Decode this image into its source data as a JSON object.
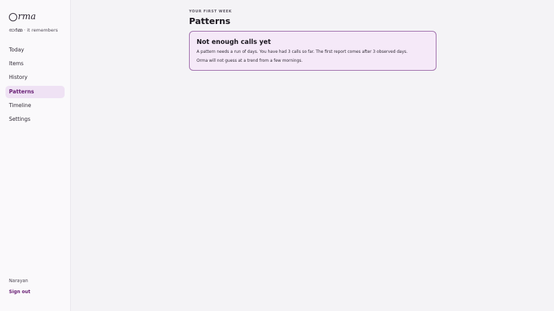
{
  "brand": {
    "logo_text": "rma",
    "tagline": "ഓർമ്മ · it remembers"
  },
  "nav": {
    "items": [
      {
        "label": "Today"
      },
      {
        "label": "Items"
      },
      {
        "label": "History"
      },
      {
        "label": "Patterns",
        "active": true
      },
      {
        "label": "Timeline"
      },
      {
        "label": "Settings"
      }
    ]
  },
  "user": {
    "name": "Narayan",
    "sign_out": "Sign out"
  },
  "page": {
    "eyebrow": "YOUR FIRST WEEK",
    "title": "Patterns"
  },
  "notice": {
    "title": "Not enough calls yet",
    "line1": "A pattern needs a run of days. You have had 3 calls so far. The first report comes after 3 observed days.",
    "line2": "Orma will not guess at a trend from a few mornings."
  },
  "colors": {
    "accent": "#6a2176",
    "active_bg": "#efe2f4",
    "notice_bg": "#f5e9f8",
    "notice_border": "#9c6aa8"
  }
}
